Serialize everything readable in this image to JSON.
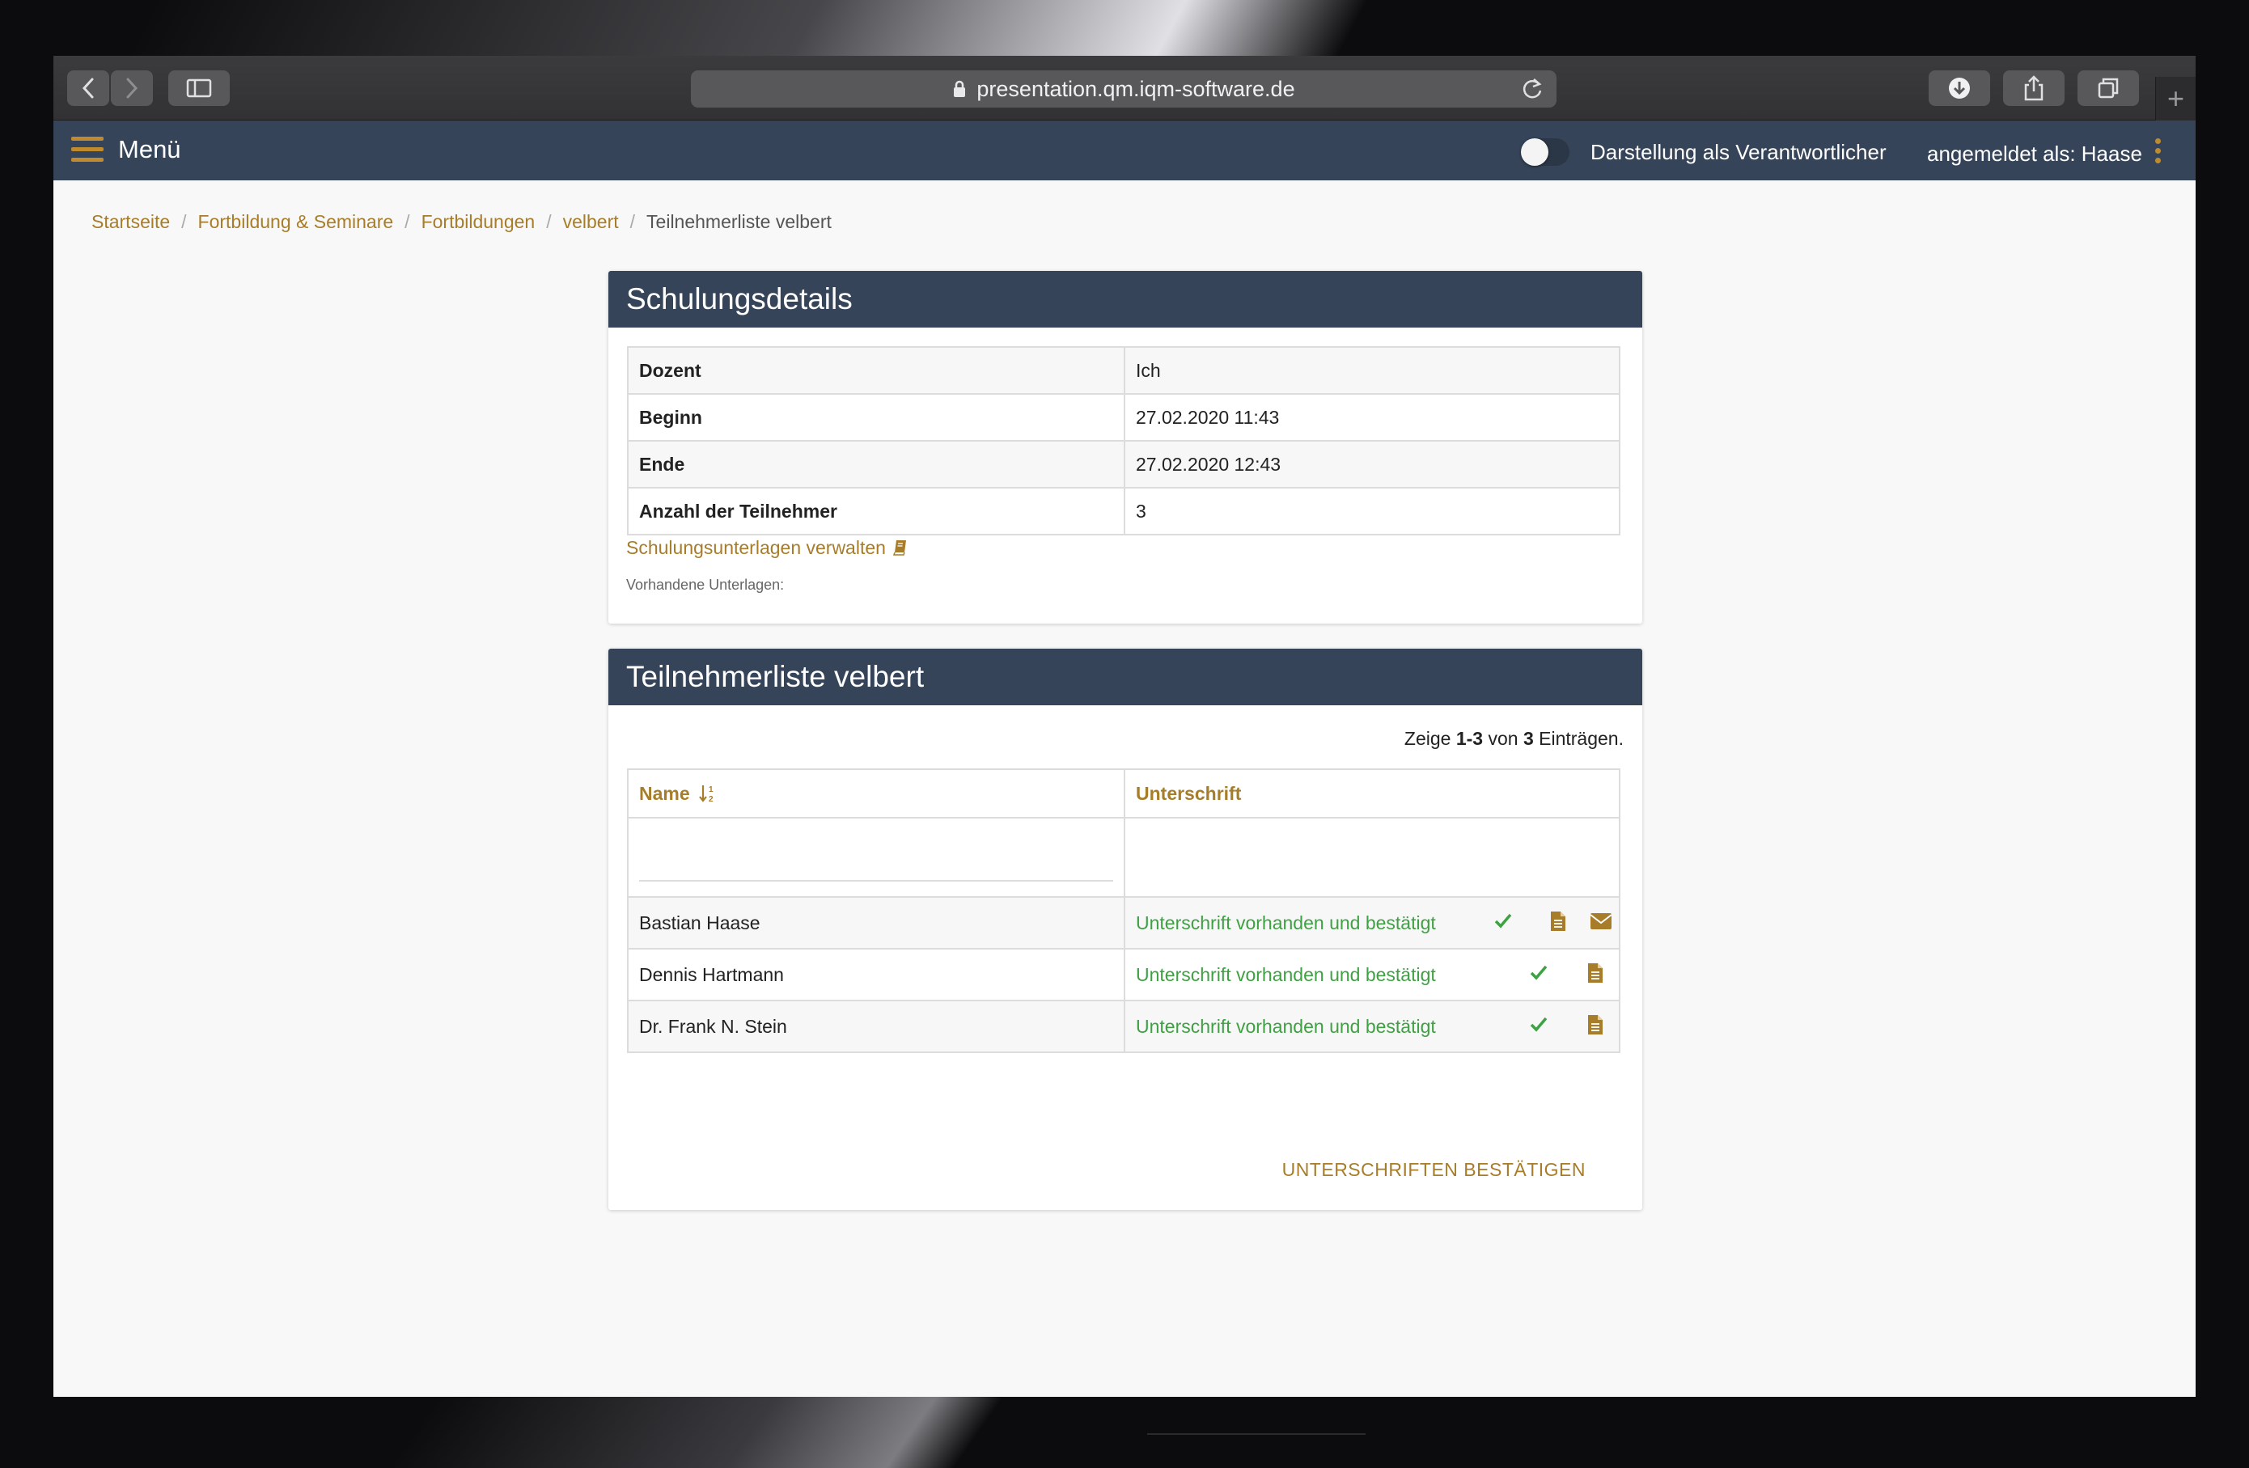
{
  "browser": {
    "url": "presentation.qm.iqm-software.de",
    "new_tab_glyph": "+"
  },
  "app": {
    "menu_label": "Menü",
    "toggle_label": "Darstellung als Verantwortlicher",
    "toggle_on": false,
    "user_label": "angemeldet als: Haase",
    "accent_color": "#c08b2e",
    "header_color": "#354459"
  },
  "breadcrumb": {
    "items": [
      "Startseite",
      "Fortbildung & Seminare",
      "Fortbildungen",
      "velbert"
    ],
    "current": "Teilnehmerliste velbert",
    "separator": "/"
  },
  "details": {
    "title": "Schulungsdetails",
    "rows": [
      {
        "key": "Dozent",
        "value": "Ich"
      },
      {
        "key": "Beginn",
        "value": "27.02.2020 11:43"
      },
      {
        "key": "Ende",
        "value": "27.02.2020 12:43"
      },
      {
        "key": "Anzahl der Teilnehmer",
        "value": "3"
      }
    ],
    "manage_link": "Schulungsunterlagen verwalten",
    "docs_label": "Vorhandene Unterlagen:"
  },
  "participants": {
    "title": "Teilnehmerliste velbert",
    "count_prefix": "Zeige ",
    "count_range": "1-3",
    "count_mid": " von ",
    "count_total": "3",
    "count_suffix": " Einträgen.",
    "col_name": "Name",
    "col_signature": "Unterschrift",
    "filter_value": "",
    "rows": [
      {
        "name": "Bastian Haase",
        "signature": "Unterschrift vorhanden und bestätigt",
        "icons": [
          "check-icon",
          "document-icon",
          "envelope-icon"
        ]
      },
      {
        "name": "Dennis Hartmann",
        "signature": "Unterschrift vorhanden und bestätigt",
        "icons": [
          "check-icon",
          "document-icon"
        ]
      },
      {
        "name": "Dr. Frank N. Stein",
        "signature": "Unterschrift vorhanden und bestätigt",
        "icons": [
          "check-icon",
          "document-icon"
        ]
      }
    ],
    "confirm_button": "UNTERSCHRIFTEN BESTÄTIGEN"
  }
}
